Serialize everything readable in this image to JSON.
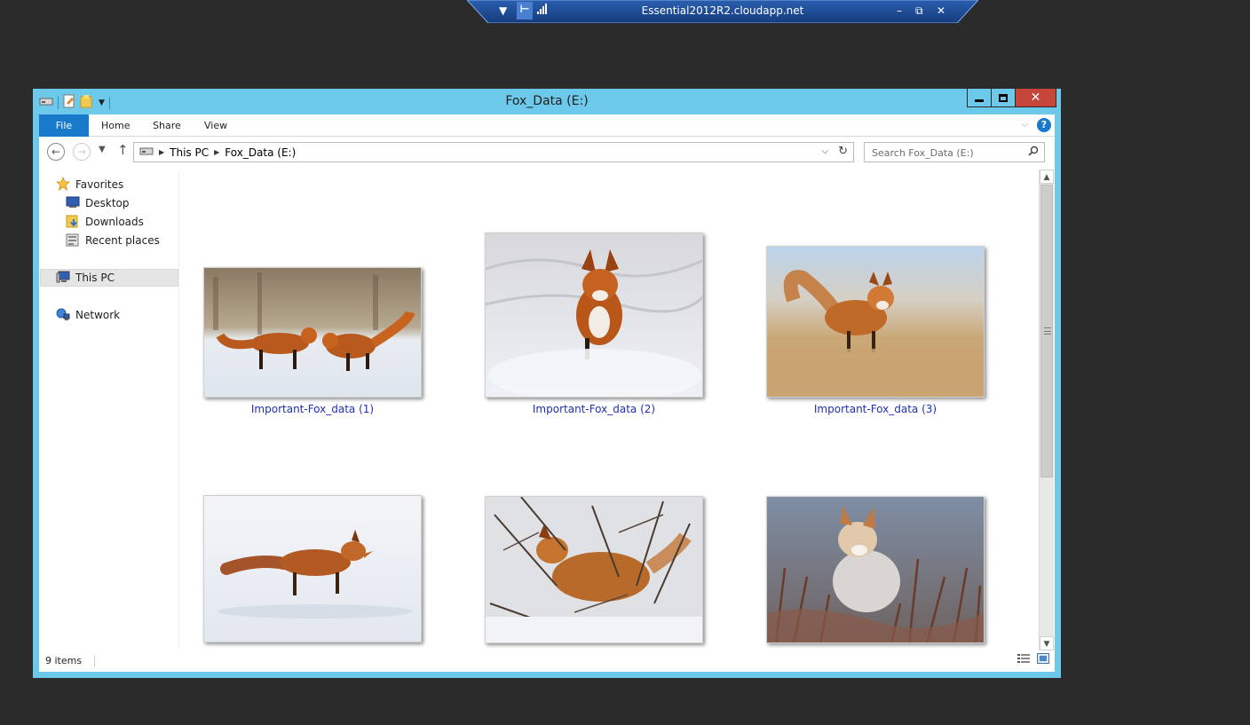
{
  "remote_bar": {
    "title": "Essential2012R2.cloudapp.net",
    "bg_color": "#1d4d97"
  },
  "window": {
    "title": "Fox_Data (E:)",
    "frame_color": "#6cc9ea",
    "close_color": "#c7463a"
  },
  "ribbon": {
    "tabs": [
      {
        "label": "File"
      },
      {
        "label": "Home"
      },
      {
        "label": "Share"
      },
      {
        "label": "View"
      }
    ],
    "accent": "#1979ca"
  },
  "address": {
    "crumbs": [
      "This PC",
      "Fox_Data (E:)"
    ]
  },
  "search": {
    "placeholder": "Search Fox_Data (E:)"
  },
  "nav_pane": {
    "favorites": "Favorites",
    "desktop": "Desktop",
    "downloads": "Downloads",
    "recent": "Recent places",
    "this_pc": "This PC",
    "network": "Network"
  },
  "files": [
    {
      "name": "Important-Fox_data (1)"
    },
    {
      "name": "Important-Fox_data (2)"
    },
    {
      "name": "Important-Fox_data (3)"
    },
    {
      "name": ""
    },
    {
      "name": ""
    },
    {
      "name": ""
    }
  ],
  "status": {
    "item_count": "9 items"
  }
}
